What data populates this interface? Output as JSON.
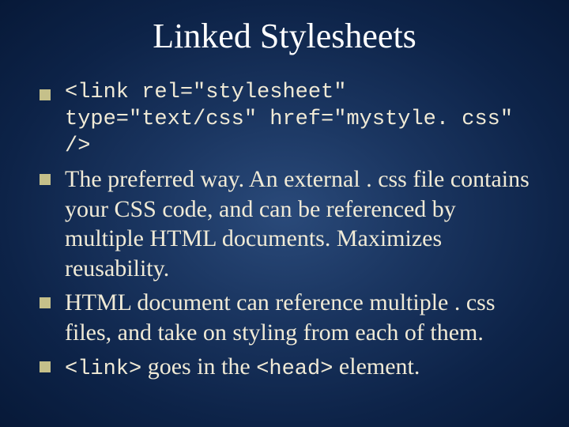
{
  "title": "Linked Stylesheets",
  "bullets": {
    "b0": "<link rel=\"stylesheet\" type=\"text/css\" href=\"mystyle. css\" />",
    "b1": "The preferred way.  An external . css file contains your CSS code, and can be referenced by multiple HTML documents.  Maximizes reusability.",
    "b2": "HTML document can reference multiple . css files, and take on styling from each of them.",
    "b3_pre": "<link>",
    "b3_mid": " goes in the ",
    "b3_post": "<head>",
    "b3_end": " element."
  }
}
